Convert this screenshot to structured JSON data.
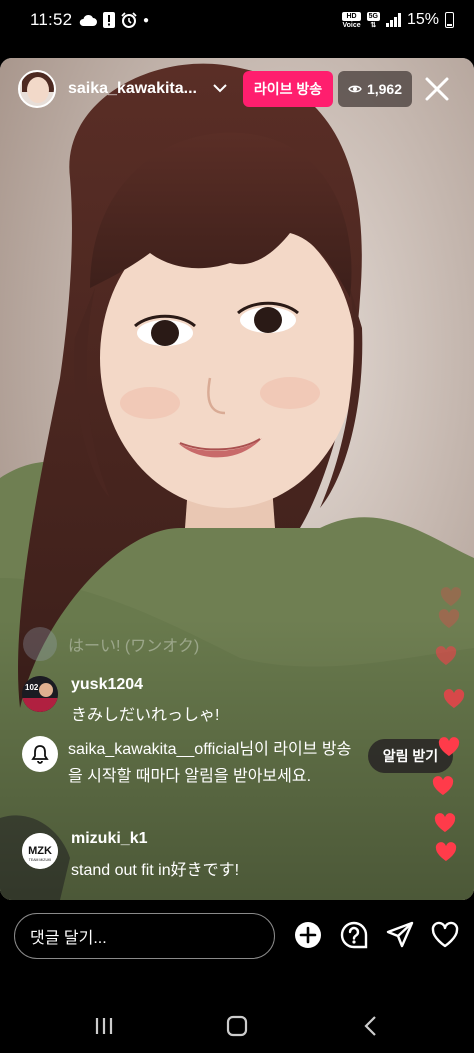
{
  "status_bar": {
    "time": "11:52",
    "battery": "15%",
    "hd_label": "HD",
    "voice_label": "Voice",
    "network": "5G"
  },
  "header": {
    "username": "saika_kawakita...",
    "live_label": "라이브 방송",
    "viewer_count": "1,962"
  },
  "comments": [
    {
      "user": "",
      "text": "はーい! (ワンオク)"
    },
    {
      "user": "yusk1204",
      "text": "きみしだいれっしゃ!"
    },
    {
      "user": "mizuki_k1",
      "text": "stand out fit in好きです!"
    }
  ],
  "avatar_labels": {
    "yusk_badge": "102",
    "mizuki_logo": "MZK",
    "mizuki_sub": "TEAM MIZUKI"
  },
  "notice": {
    "text": "saika_kawakita__official님이 라이브 방송을 시작할 때마다 알림을 받아보세요.",
    "button": "알림 받기"
  },
  "bottom": {
    "input_placeholder": "댓글 달기..."
  },
  "colors": {
    "live_badge": "#ff1e6e",
    "heart": "#ff3b4a",
    "background": "#000000"
  },
  "icons": [
    "cloud-icon",
    "alert-icon",
    "alarm-icon",
    "signal-icon",
    "battery-icon",
    "eye-icon",
    "close-icon",
    "bell-icon",
    "heart-icon",
    "add-icon",
    "question-icon",
    "send-icon",
    "like-icon",
    "recents-icon",
    "home-icon",
    "back-icon"
  ]
}
